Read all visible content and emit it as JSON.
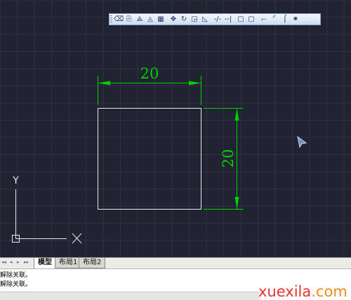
{
  "colors": {
    "canvas_bg": "#212232",
    "grid_line": "#2d3144",
    "geometry": "#e8e8e8",
    "dimension": "#00d000",
    "ucs": "#e8e8e8"
  },
  "toolbar": {
    "buttons": [
      {
        "name": "erase-icon",
        "glyph": "⌫"
      },
      {
        "name": "copy-icon",
        "glyph": "⎘"
      },
      {
        "name": "mirror-icon",
        "glyph": "⟁"
      },
      {
        "name": "offset-icon",
        "glyph": "◬"
      },
      {
        "name": "array-icon",
        "glyph": "▦"
      },
      {
        "name": "move-icon",
        "glyph": "✥"
      },
      {
        "name": "rotate-icon",
        "glyph": "↻"
      },
      {
        "name": "scale-icon",
        "glyph": "◲"
      },
      {
        "name": "stretch-icon",
        "glyph": "◺"
      },
      {
        "name": "trim-icon",
        "glyph": "-/-"
      },
      {
        "name": "extend-icon",
        "glyph": "--|"
      },
      {
        "name": "break-at-point-icon",
        "glyph": "▢"
      },
      {
        "name": "break-icon",
        "glyph": "▢"
      },
      {
        "name": "join-icon",
        "glyph": "⤚"
      },
      {
        "name": "chamfer-icon",
        "glyph": "⌜"
      },
      {
        "name": "fillet-icon",
        "glyph": "⌠"
      },
      {
        "name": "explode-icon",
        "glyph": "✷"
      }
    ]
  },
  "drawing": {
    "horizontal_dimension_text": "20",
    "vertical_dimension_text": "20",
    "ucs_label": "Y"
  },
  "tabs": {
    "nav_arrows": [
      "◂◂",
      "◂",
      "▸",
      "▸▸"
    ],
    "items": [
      {
        "label": "模型",
        "active": true
      },
      {
        "label": "布局1",
        "active": false
      },
      {
        "label": "布局2",
        "active": false
      }
    ]
  },
  "command_line": {
    "lines": [
      "解除关联。",
      "解除关联。"
    ]
  },
  "watermark": {
    "main": "xuexila",
    "tld": ".com"
  }
}
